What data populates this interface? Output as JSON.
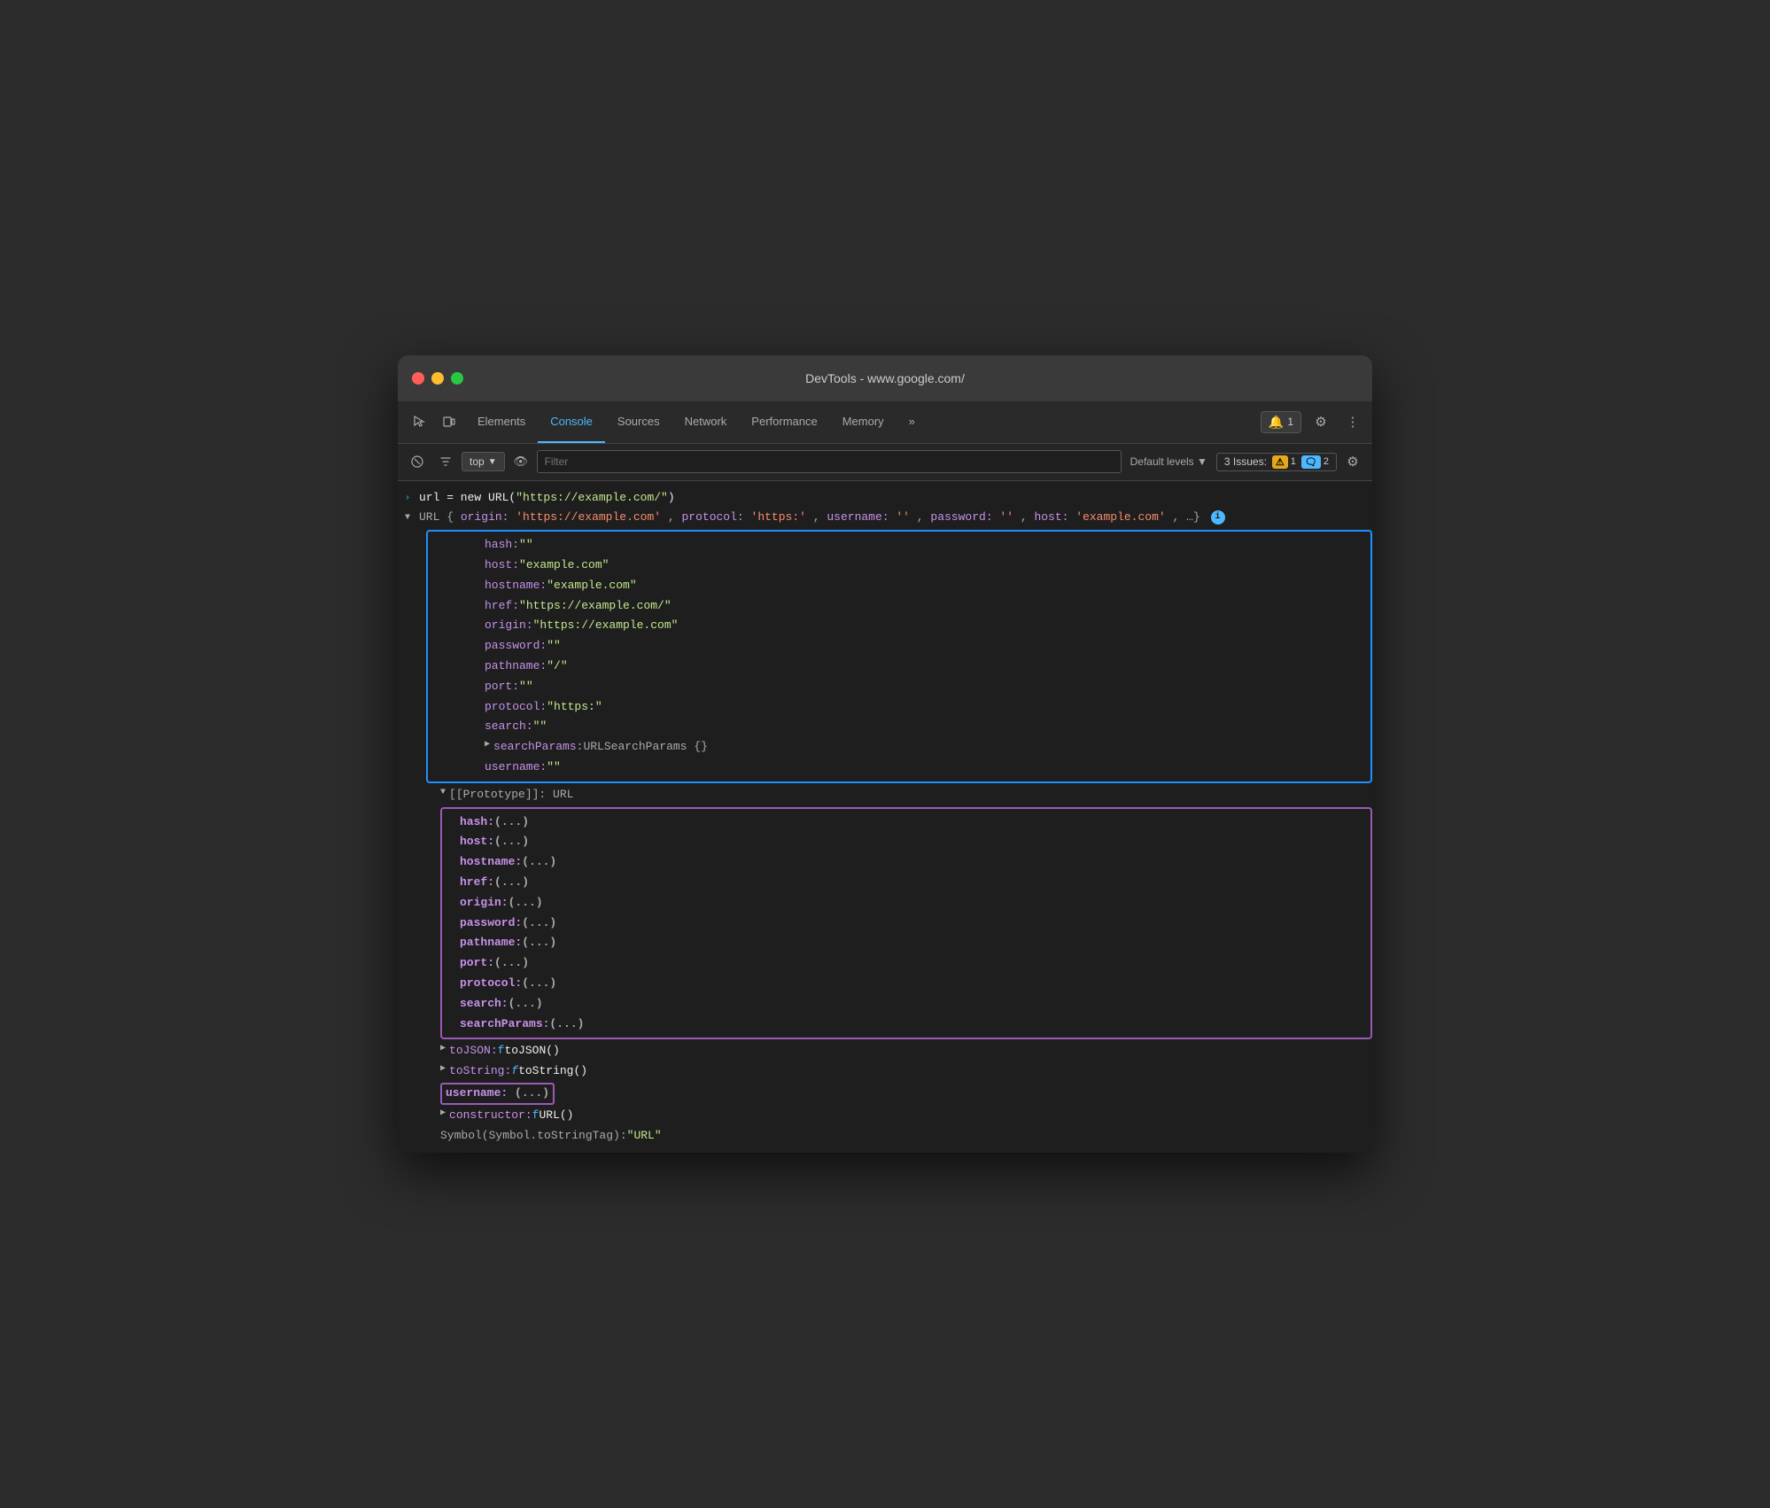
{
  "window": {
    "title": "DevTools - www.google.com/"
  },
  "tabs": {
    "items": [
      {
        "label": "Elements",
        "active": false
      },
      {
        "label": "Console",
        "active": true
      },
      {
        "label": "Sources",
        "active": false
      },
      {
        "label": "Network",
        "active": false
      },
      {
        "label": "Performance",
        "active": false
      },
      {
        "label": "Memory",
        "active": false
      },
      {
        "label": "»",
        "active": false
      }
    ]
  },
  "toolbar": {
    "badge_count": "1",
    "issues_label": "3 Issues:",
    "issues_warn": "1",
    "issues_info": "2",
    "filter_placeholder": "Filter",
    "levels_label": "Default levels ▼",
    "context_label": "top"
  },
  "console": {
    "line1": {
      "arrow": "›",
      "prefix": "url = new URL(",
      "url_string": "\"https://example.com/\"",
      "suffix": ")"
    },
    "line2_label": "URL {",
    "line2_props": "origin: 'https://example.com', protocol: 'https:', username: '', password: '', host: 'example.com', …}",
    "props": {
      "hash": "hash: \"\"",
      "host": "host: \"example.com\"",
      "hostname": "hostname: \"example.com\"",
      "href": "href: \"https://example.com/\"",
      "origin": "origin: \"https://example.com\"",
      "password": "password: \"\"",
      "pathname": "pathname: \"/\"",
      "port": "port: \"\"",
      "protocol": "protocol: \"https:\"",
      "search": "search: \"\"",
      "searchParams": "searchParams: URLSearchParams {}",
      "username": "username: \"\""
    },
    "prototype": "[[Prototype]]: URL",
    "proto_props": {
      "hash": "hash: (...)",
      "host": "host: (...)",
      "hostname": "hostname: (...)",
      "href": "href: (...)",
      "origin": "origin: (...)",
      "password": "password: (...)",
      "pathname": "pathname: (...)",
      "port": "port: (...)",
      "protocol": "protocol: (...)",
      "search": "search: (...)",
      "searchParams": "searchParams: (...)"
    },
    "toJSON": "toJSON: f toJSON()",
    "toString": "toString: f toString()",
    "username_proto": "username: (...)",
    "constructor": "constructor: f URL()",
    "symbol": "Symbol(Symbol.toStringTag): \"URL\""
  }
}
